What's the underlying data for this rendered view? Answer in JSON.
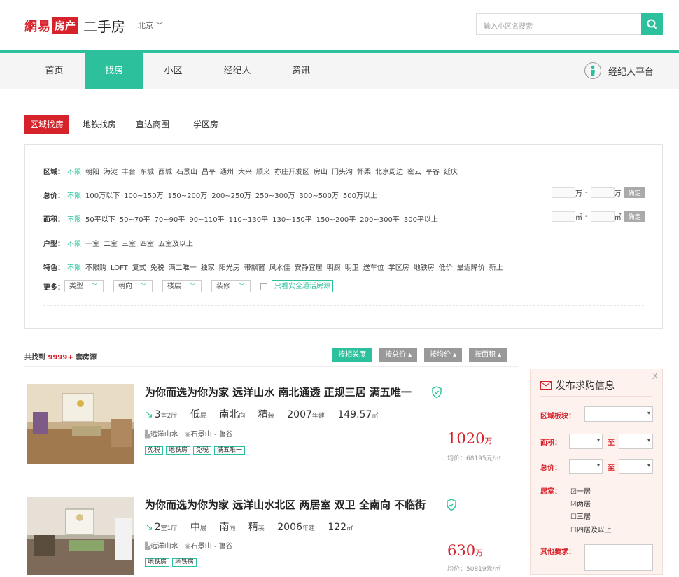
{
  "header": {
    "logo_part1": "網易",
    "logo_part2": "房产",
    "section": "二手房",
    "city": "北京",
    "search_placeholder": "输入小区名搜索"
  },
  "nav": {
    "items": [
      "首页",
      "找房",
      "小区",
      "经纪人",
      "资讯"
    ],
    "active": "找房",
    "agent_platform": "经纪人平台"
  },
  "tabs": {
    "items": [
      "区域找房",
      "地铁找房",
      "直达商圈",
      "学区房"
    ],
    "active": "区域找房"
  },
  "filters": {
    "area": {
      "label": "区域：",
      "options": [
        "不限",
        "朝阳",
        "海淀",
        "丰台",
        "东城",
        "西城",
        "石景山",
        "昌平",
        "通州",
        "大兴",
        "顺义",
        "亦庄开发区",
        "房山",
        "门头沟",
        "怀柔",
        "北京周边",
        "密云",
        "平谷",
        "延庆"
      ]
    },
    "price": {
      "label": "总价：",
      "options": [
        "不限",
        "100万以下",
        "100~150万",
        "150~200万",
        "200~250万",
        "250~300万",
        "300~500万",
        "500万以上"
      ],
      "unit": "万",
      "dash": "-",
      "confirm": "确定"
    },
    "size": {
      "label": "面积：",
      "options": [
        "不限",
        "50平以下",
        "50~70平",
        "70~90平",
        "90~110平",
        "110~130平",
        "130~150平",
        "150~200平",
        "200~300平",
        "300平以上"
      ],
      "unit": "㎡",
      "dash": "-",
      "confirm": "确定"
    },
    "rooms": {
      "label": "户型：",
      "options": [
        "不限",
        "一室",
        "二室",
        "三室",
        "四室",
        "五室及以上"
      ]
    },
    "features": {
      "label": "特色：",
      "options": [
        "不限",
        "不限购",
        "LOFT",
        "复式",
        "免税",
        "满二唯一",
        "独家",
        "阳光房",
        "带飘窗",
        "风水佳",
        "安静宜居",
        "明厨",
        "明卫",
        "送车位",
        "学区房",
        "地铁房",
        "低价",
        "最近降价",
        "新上"
      ]
    },
    "more": {
      "label": "更多：",
      "dropdowns": [
        "类型",
        "朝向",
        "楼层",
        "装修"
      ],
      "safe_call": "只看安全通话房源"
    }
  },
  "results": {
    "count_prefix": "共找到",
    "count": "9999+",
    "count_suffix": "套房源",
    "sort": [
      "按相关度",
      "按总价 ▴",
      "按均价 ▴",
      "按面积 ▴"
    ]
  },
  "listings": [
    {
      "title": "为你而选为你为家 远洋山水 南北通透 正规三居 满五唯一",
      "rooms": "3",
      "rooms_unit": "室2厅",
      "floor": "低",
      "floor_unit": "层",
      "orient": "南北",
      "orient_unit": "向",
      "deco": "精",
      "deco_unit": "装",
      "year": "2007",
      "year_unit": "年建",
      "area": "149.57",
      "area_unit": "㎡",
      "community": "远洋山水",
      "district": "石景山 - 鲁谷",
      "tags": [
        "免税",
        "地铁房",
        "免税",
        "满五唯一"
      ],
      "price": "1020",
      "price_unit": "万",
      "unit_price": "均价：68195元/㎡"
    },
    {
      "title": "为你而选为你为家 远洋山水北区 两居室 双卫 全南向 不临街",
      "rooms": "2",
      "rooms_unit": "室1厅",
      "floor": "中",
      "floor_unit": "层",
      "orient": "南",
      "orient_unit": "向",
      "deco": "精",
      "deco_unit": "装",
      "year": "2006",
      "year_unit": "年建",
      "area": "122",
      "area_unit": "㎡",
      "community": "远洋山水",
      "district": "石景山 - 鲁谷",
      "tags": [
        "地铁房",
        "地铁房"
      ],
      "price": "630",
      "price_unit": "万",
      "unit_price": "均价：50819元/㎡"
    }
  ],
  "side": {
    "close": "X",
    "title": "发布求购信息",
    "district_label": "区域板块：",
    "area_label": "面积：",
    "price_label": "总价：",
    "to": "至",
    "rooms_label": "居室：",
    "room_opts": [
      "☑一居",
      "☑两居",
      "☐三居",
      "☐四居及以上"
    ],
    "other_label": "其他要求："
  },
  "colors": {
    "brand_green": "#2cc19c",
    "brand_red": "#d6222a"
  }
}
